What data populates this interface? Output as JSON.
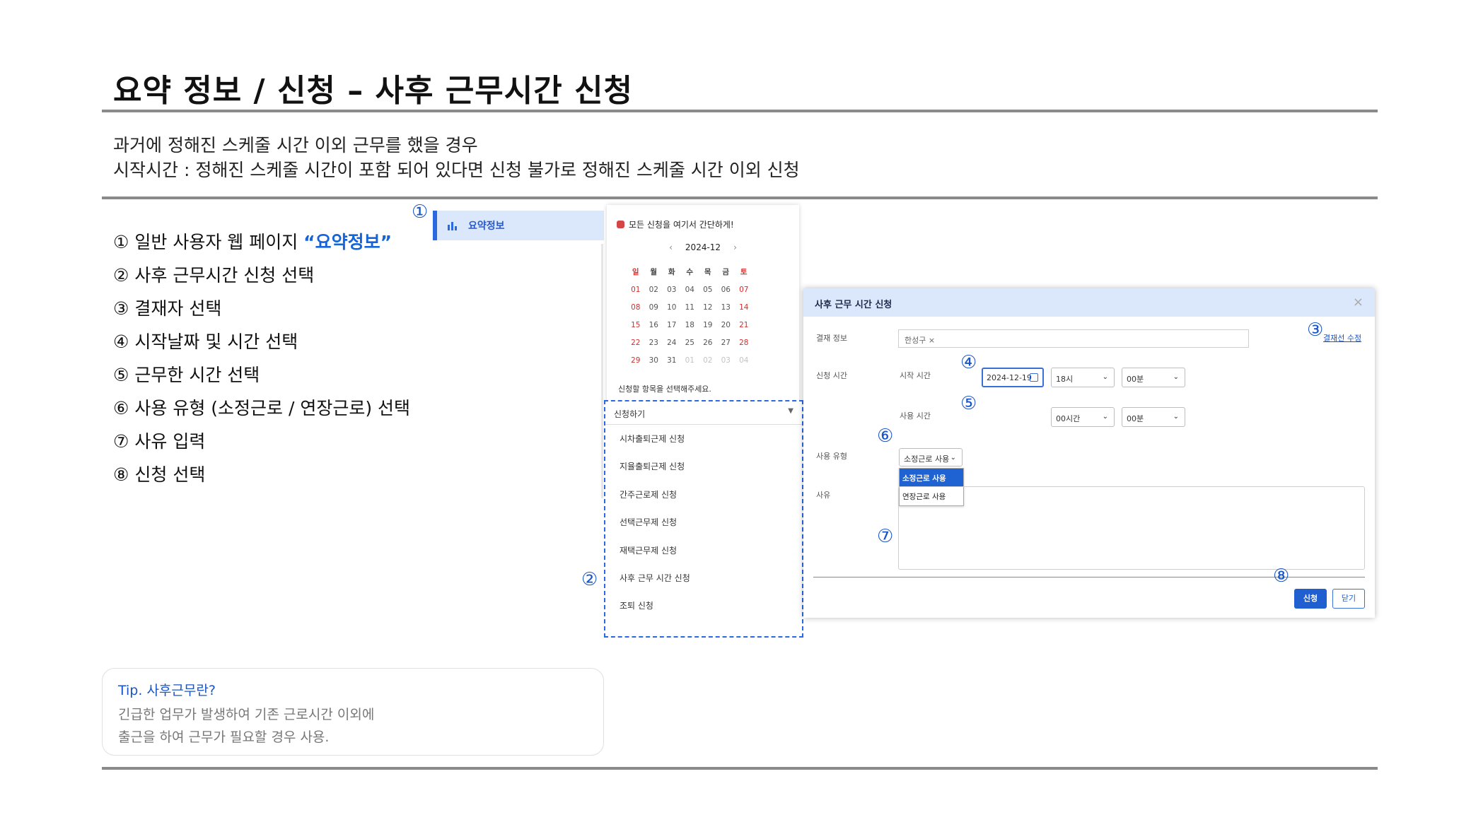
{
  "header": {
    "title": "요약 정보 / 신청 – 사후 근무시간 신청",
    "desc_line1": "과거에 정해진 스케줄 시간 이외 근무를 했을 경우",
    "desc_line2": "시작시간 : 정해진 스케줄 시간이 포함 되어 있다면 신청 불가로 정해진 스케줄 시간 이외 신청"
  },
  "steps": [
    {
      "num": "①",
      "pre": " 일반 사용자 웹 페이지 ",
      "highlight": "“요약정보”"
    },
    {
      "num": "②",
      "text": " 사후 근무시간 신청 선택"
    },
    {
      "num": "③",
      "text": " 결재자 선택"
    },
    {
      "num": "④",
      "text": " 시작날짜 및 시간 선택"
    },
    {
      "num": "⑤",
      "text": " 근무한 시간 선택"
    },
    {
      "num": "⑥",
      "text": " 사용 유형 (소정근로 / 연장근로) 선택"
    },
    {
      "num": "⑦",
      "text": " 사유 입력"
    },
    {
      "num": "⑧",
      "text": " 신청 선택"
    }
  ],
  "markers": {
    "m1": "①",
    "m2": "②",
    "m3": "③",
    "m4": "④",
    "m5": "⑤",
    "m6": "⑥",
    "m7": "⑦",
    "m8": "⑧"
  },
  "sidebar": {
    "label": "요약정보",
    "icon": "bar-chart-icon"
  },
  "calendar": {
    "header": "모든 신청을 여기서 간단하게!",
    "month": "2024-12",
    "prev": "‹",
    "next": "›",
    "weekdays": [
      "일",
      "월",
      "화",
      "수",
      "목",
      "금",
      "토"
    ],
    "weeks": [
      [
        "01",
        "02",
        "03",
        "04",
        "05",
        "06",
        "07"
      ],
      [
        "08",
        "09",
        "10",
        "11",
        "12",
        "13",
        "14"
      ],
      [
        "15",
        "16",
        "17",
        "18",
        "19",
        "20",
        "21"
      ],
      [
        "22",
        "23",
        "24",
        "25",
        "26",
        "27",
        "28"
      ],
      [
        "29",
        "30",
        "31",
        "01",
        "02",
        "03",
        "04"
      ]
    ],
    "hint": "신청할 항목을 선택해주세요."
  },
  "dropdown": {
    "selected": "신청하기",
    "items": [
      "시차출퇴근제 신청",
      "지율출퇴근제 신청",
      "간주근로제 신청",
      "선택근무제 신청",
      "재택근무제 신청",
      "사후 근무 시간 신청",
      "조퇴 신청"
    ]
  },
  "modal": {
    "title": "사후 근무 시간 신청",
    "close": "×",
    "approval_label": "결재 정보",
    "approver": "한성구 ×",
    "approval_link": "결재선 수정",
    "apply_time_label": "신청 시간",
    "start_time_label": "시작 시간",
    "start_date": "2024-12-19",
    "start_hour": "18시",
    "start_min": "00분",
    "use_time_label": "사용 시간",
    "use_hour": "00시간",
    "use_min": "00분",
    "use_type_label": "사용 유형",
    "use_type_selected": "소정근로 사용",
    "use_type_options": [
      "소정근로 사용",
      "연장근로 사용"
    ],
    "reason_label": "사유",
    "submit": "신청",
    "cancel": "닫기"
  },
  "tip": {
    "title": "Tip. 사후근무란?",
    "line1": "긴급한 업무가 발생하여 기존 근로시간 이외에",
    "line2": "출근을 하여 근무가 필요할 경우 사용."
  },
  "colors": {
    "accent": "#1a55c4",
    "header_bg": "#dbe7fb",
    "primary_button": "#1f5fd0",
    "holiday": "#d62e2e"
  }
}
